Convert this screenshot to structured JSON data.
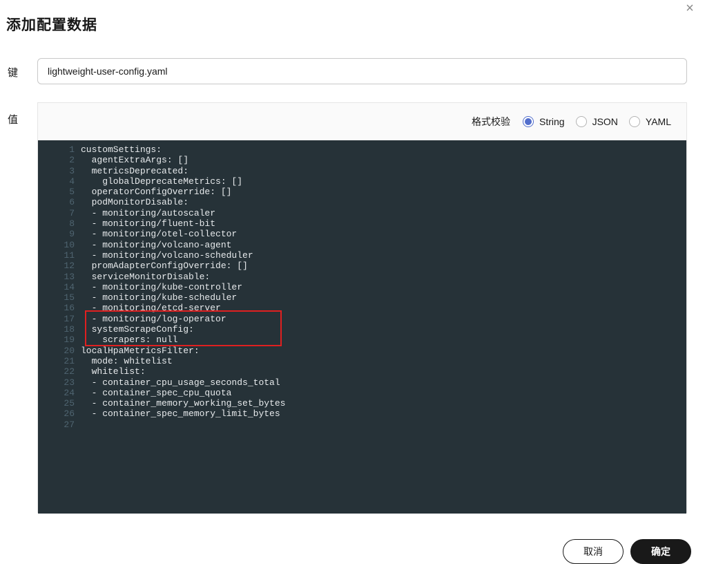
{
  "dialog": {
    "title": "添加配置数据",
    "close_icon": "×"
  },
  "form": {
    "key_label": "键",
    "key_value": "lightweight-user-config.yaml",
    "value_label": "值"
  },
  "format": {
    "label": "格式校验",
    "options": [
      {
        "label": "String",
        "checked": true
      },
      {
        "label": "JSON",
        "checked": false
      },
      {
        "label": "YAML",
        "checked": false
      }
    ]
  },
  "code_lines": [
    {
      "n": "1",
      "t": "customSettings:"
    },
    {
      "n": "2",
      "t": "  agentExtraArgs: []"
    },
    {
      "n": "3",
      "t": "  metricsDeprecated:"
    },
    {
      "n": "4",
      "t": "    globalDeprecateMetrics: []"
    },
    {
      "n": "5",
      "t": "  operatorConfigOverride: []"
    },
    {
      "n": "6",
      "t": "  podMonitorDisable:"
    },
    {
      "n": "7",
      "t": "  - monitoring/autoscaler"
    },
    {
      "n": "8",
      "t": "  - monitoring/fluent-bit"
    },
    {
      "n": "9",
      "t": "  - monitoring/otel-collector"
    },
    {
      "n": "10",
      "t": "  - monitoring/volcano-agent"
    },
    {
      "n": "11",
      "t": "  - monitoring/volcano-scheduler"
    },
    {
      "n": "12",
      "t": "  promAdapterConfigOverride: []"
    },
    {
      "n": "13",
      "t": "  serviceMonitorDisable:"
    },
    {
      "n": "14",
      "t": "  - monitoring/kube-controller"
    },
    {
      "n": "15",
      "t": "  - monitoring/kube-scheduler"
    },
    {
      "n": "16",
      "t": "  - monitoring/etcd-server"
    },
    {
      "n": "17",
      "t": "  - monitoring/log-operator"
    },
    {
      "n": "18",
      "t": "  systemScrapeConfig:"
    },
    {
      "n": "19",
      "t": "    scrapers: null"
    },
    {
      "n": "20",
      "t": "localHpaMetricsFilter:"
    },
    {
      "n": "21",
      "t": "  mode: whitelist"
    },
    {
      "n": "22",
      "t": "  whitelist:"
    },
    {
      "n": "23",
      "t": "  - container_cpu_usage_seconds_total"
    },
    {
      "n": "24",
      "t": "  - container_spec_cpu_quota"
    },
    {
      "n": "25",
      "t": "  - container_memory_working_set_bytes"
    },
    {
      "n": "26",
      "t": "  - container_spec_memory_limit_bytes"
    },
    {
      "n": "27",
      "t": ""
    }
  ],
  "buttons": {
    "cancel": "取消",
    "ok": "确定"
  },
  "colors": {
    "code_bg": "#263238",
    "radio_accent": "#526ecc",
    "highlight": "#e02020"
  }
}
